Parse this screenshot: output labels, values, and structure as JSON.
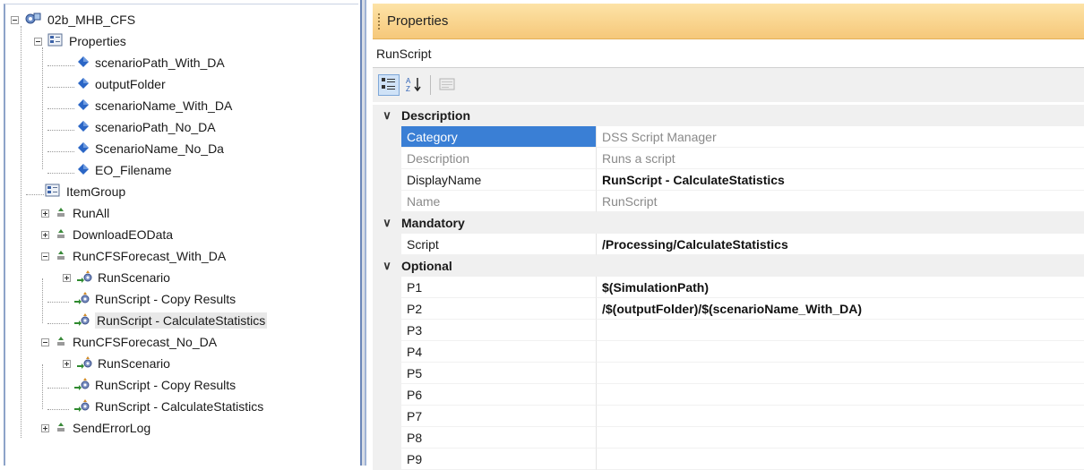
{
  "tree": {
    "root": "02b_MHB_CFS",
    "properties_folder": "Properties",
    "properties": [
      "scenarioPath_With_DA",
      "outputFolder",
      "scenarioName_With_DA",
      "scenarioPath_No_DA",
      "ScenarioName_No_Da",
      "EO_Filename"
    ],
    "item_group": "ItemGroup",
    "run_all": "RunAll",
    "download": "DownloadEOData",
    "forecast_with": "RunCFSForecast_With_DA",
    "with_children": [
      "RunScenario",
      "RunScript - Copy Results",
      "RunScript - CalculateStatistics"
    ],
    "forecast_no": "RunCFSForecast_No_DA",
    "no_children": [
      "RunScenario",
      "RunScript - Copy Results",
      "RunScript - CalculateStatistics"
    ],
    "send_error": "SendErrorLog"
  },
  "panel": {
    "title": "Properties",
    "object": "RunScript"
  },
  "grid": {
    "description_cat": "Description",
    "category_name": "Category",
    "category_value": "DSS Script Manager",
    "description_name": "Description",
    "description_value": "Runs a script",
    "displayname_name": "DisplayName",
    "displayname_value": "RunScript - CalculateStatistics",
    "name_name": "Name",
    "name_value": "RunScript",
    "mandatory_cat": "Mandatory",
    "script_name": "Script",
    "script_value": "/Processing/CalculateStatistics",
    "optional_cat": "Optional",
    "p1_name": "P1",
    "p1_value": "$(SimulationPath)",
    "p2_name": "P2",
    "p2_value": "/$(outputFolder)/$(scenarioName_With_DA)",
    "p3_name": "P3",
    "p4_name": "P4",
    "p5_name": "P5",
    "p6_name": "P6",
    "p7_name": "P7",
    "p8_name": "P8",
    "p9_name": "P9"
  },
  "icons": {
    "expander": "tree-expander-icon",
    "gear": "gear-cube-icon",
    "properties": "properties-folder-icon",
    "diamond": "property-diamond-icon",
    "task": "task-icon",
    "script": "script-run-icon",
    "categorized": "categorized-view-icon",
    "alphabetical": "alphabetical-sort-icon",
    "property_pages": "property-pages-icon"
  },
  "colors": {
    "header": "#f6c87a",
    "selection": "#3a7fd5",
    "diamond": "#2b66c6"
  }
}
